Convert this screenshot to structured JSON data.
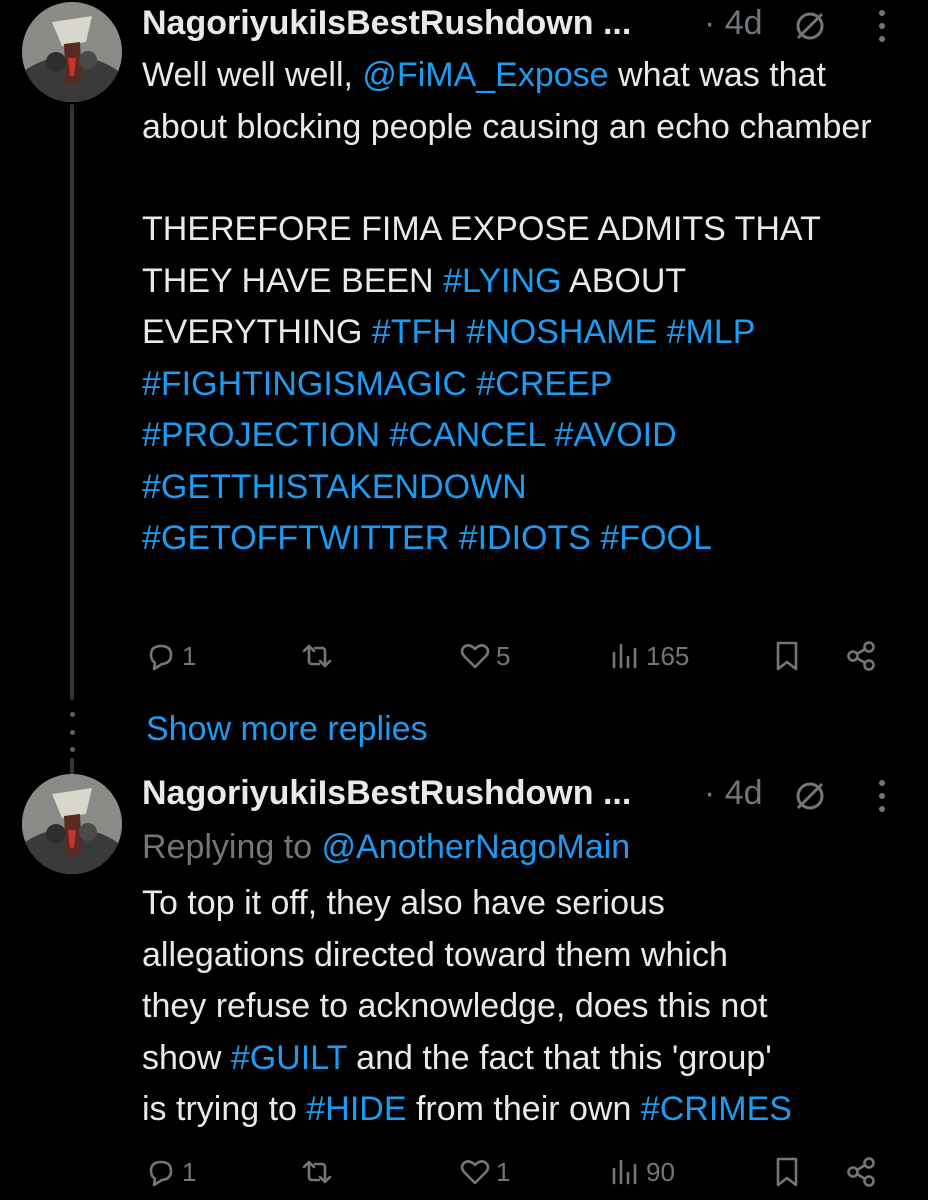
{
  "tweets": [
    {
      "display_name": "NagoriyukiIsBestRushdown ...",
      "timestamp": "· 4d",
      "text_intro": "Well well well, ",
      "mention": "@FiMA_Expose",
      "text_rest": " what was that about blocking people causing an echo chamber",
      "paragraph2_a": "THEREFORE FIMA EXPOSE ADMITS THAT THEY HAVE BEEN ",
      "tag_lying": "#LYING",
      "paragraph2_b": " ABOUT EVERYTHING ",
      "hashtags_1": "#TFH #NOSHAME #MLP",
      "hashtags_2": "#FIGHTINGISMAGIC #CREEP",
      "hashtags_3": "#PROJECTION #CANCEL #AVOID",
      "hashtags_4": "#GETTHISTAKENDOWN",
      "hashtags_5": "#GETOFFTWITTER #IDIOTS #FOOL",
      "stats": {
        "replies": "1",
        "retweets": "",
        "likes": "5",
        "views": "165"
      }
    },
    {
      "display_name": "NagoriyukiIsBestRushdown ...",
      "timestamp": "· 4d",
      "replying_prefix": "Replying to ",
      "replying_to": "@AnotherNagoMain",
      "line1": "To top it off, they also have serious",
      "line2": "allegations directed toward them which",
      "line3": "they refuse to acknowledge, does this not",
      "line4_a": "show ",
      "line4_tag": "#GUILT",
      "line4_b": " and the fact that this 'group'",
      "line5_a": "is trying to ",
      "line5_tag1": "#HIDE",
      "line5_b": " from their own ",
      "line5_tag2": "#CRIMES",
      "stats": {
        "replies": "1",
        "retweets": "",
        "likes": "1",
        "views": "90"
      }
    }
  ],
  "show_more_replies": "Show more replies",
  "colors": {
    "background": "#000000",
    "text": "#e7e9ea",
    "muted": "#71767b",
    "link": "#1d9bf0"
  },
  "icons": [
    "reply-icon",
    "retweet-icon",
    "like-icon",
    "views-icon",
    "bookmark-icon",
    "share-icon",
    "no-reply-icon",
    "kebab-icon"
  ]
}
